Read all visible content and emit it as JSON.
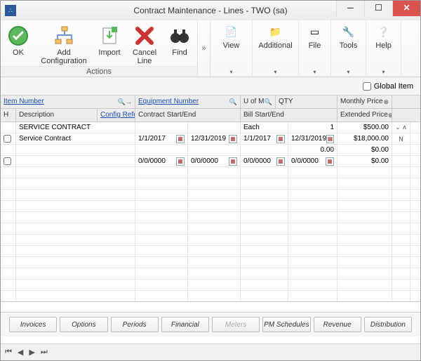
{
  "window": {
    "title": "Contract Maintenance - Lines  -  TWO (sa)"
  },
  "ribbon": {
    "ok": "OK",
    "add_config": "Add\nConfiguration",
    "import": "Import",
    "cancel_line": "Cancel\nLine",
    "find": "Find",
    "group_label": "Actions",
    "view": "View",
    "additional": "Additional",
    "file": "File",
    "tools": "Tools",
    "help": "Help"
  },
  "toolbar": {
    "global_item": "Global Item"
  },
  "headers": {
    "item_number": "Item Number",
    "equipment_number": "Equipment Number",
    "uom": "U of M",
    "qty": "QTY",
    "monthly_price": "Monthly Price",
    "h": "H",
    "description": "Description",
    "config_reference": "Config Reference",
    "contract_start_end": "Contract Start/End",
    "bill_start_end": "Bill Start/End",
    "extended_price": "Extended Price"
  },
  "rows": [
    {
      "item": "SERVICE CONTRACT",
      "uom": "Each",
      "qty": "1",
      "monthly": "$500.00"
    },
    {
      "check": false,
      "desc": "Service Contract",
      "cstart": "1/1/2017",
      "cend": "12/31/2019",
      "bstart": "1/1/2017",
      "bend": "12/31/2019",
      "ext": "$18,000.00",
      "tail": "N"
    },
    {
      "qty_val": "0.00",
      "monthly": "$0.00"
    },
    {
      "check": false,
      "cstart": "0/0/0000",
      "cend": "0/0/0000",
      "bstart": "0/0/0000",
      "bend": "0/0/0000",
      "ext": "$0.00"
    }
  ],
  "footer": {
    "invoices": "Invoices",
    "options": "Options",
    "periods": "Periods",
    "financial": "Financial",
    "meters": "Meters",
    "pm_schedules": "PM Schedules",
    "revenue": "Revenue",
    "distribution": "Distribution"
  }
}
